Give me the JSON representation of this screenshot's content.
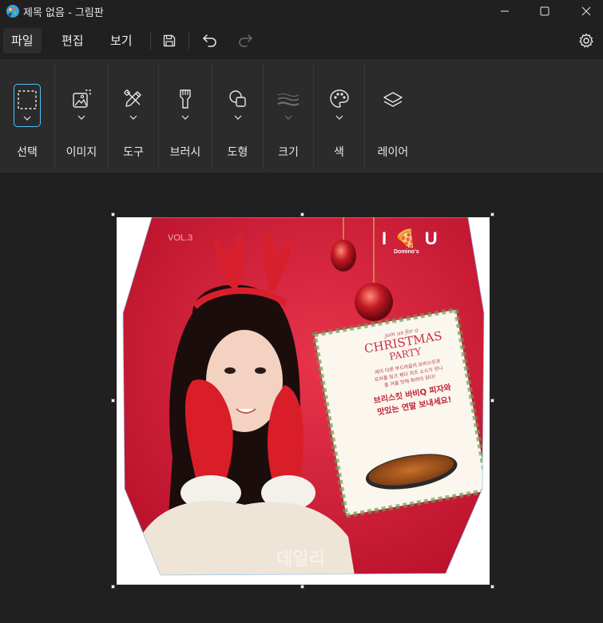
{
  "window": {
    "title": "제목 없음 - 그림판"
  },
  "menu": {
    "file": "파일",
    "edit": "편집",
    "view": "보기"
  },
  "ribbon": {
    "groups": [
      {
        "label": "선택",
        "icon": "selection-icon"
      },
      {
        "label": "이미지",
        "icon": "image-icon"
      },
      {
        "label": "도구",
        "icon": "tools-icon"
      },
      {
        "label": "브러시",
        "icon": "brush-icon"
      },
      {
        "label": "도형",
        "icon": "shapes-icon"
      },
      {
        "label": "크기",
        "icon": "size-icon"
      },
      {
        "label": "색",
        "icon": "palette-icon"
      },
      {
        "label": "레이어",
        "icon": "layers-icon"
      }
    ]
  },
  "canvas_image": {
    "volume": "VOL.3",
    "brand_logo": "I 🍕 U",
    "brand_name": "Domino's",
    "card_small": "join us for a",
    "card_title_1": "CHRISTMAS",
    "card_title_2": "PARTY",
    "card_text_1": "레이 다른 부드러움의 브리스킷과",
    "card_text_2": "트러플 링크 체다 치즈 소스가 만나",
    "card_text_3": "올 겨울 맛에 화려이 된다!",
    "card_headline_1": "브리스킷 바비Q 피자와",
    "card_headline_2": "맛있는 연말 보내세요!",
    "watermark": "데일리"
  },
  "colors": {
    "accent": "#4cc2ff",
    "app_bg": "#202020",
    "ribbon_bg": "#2b2b2b",
    "poster_red": "#d8203a"
  }
}
